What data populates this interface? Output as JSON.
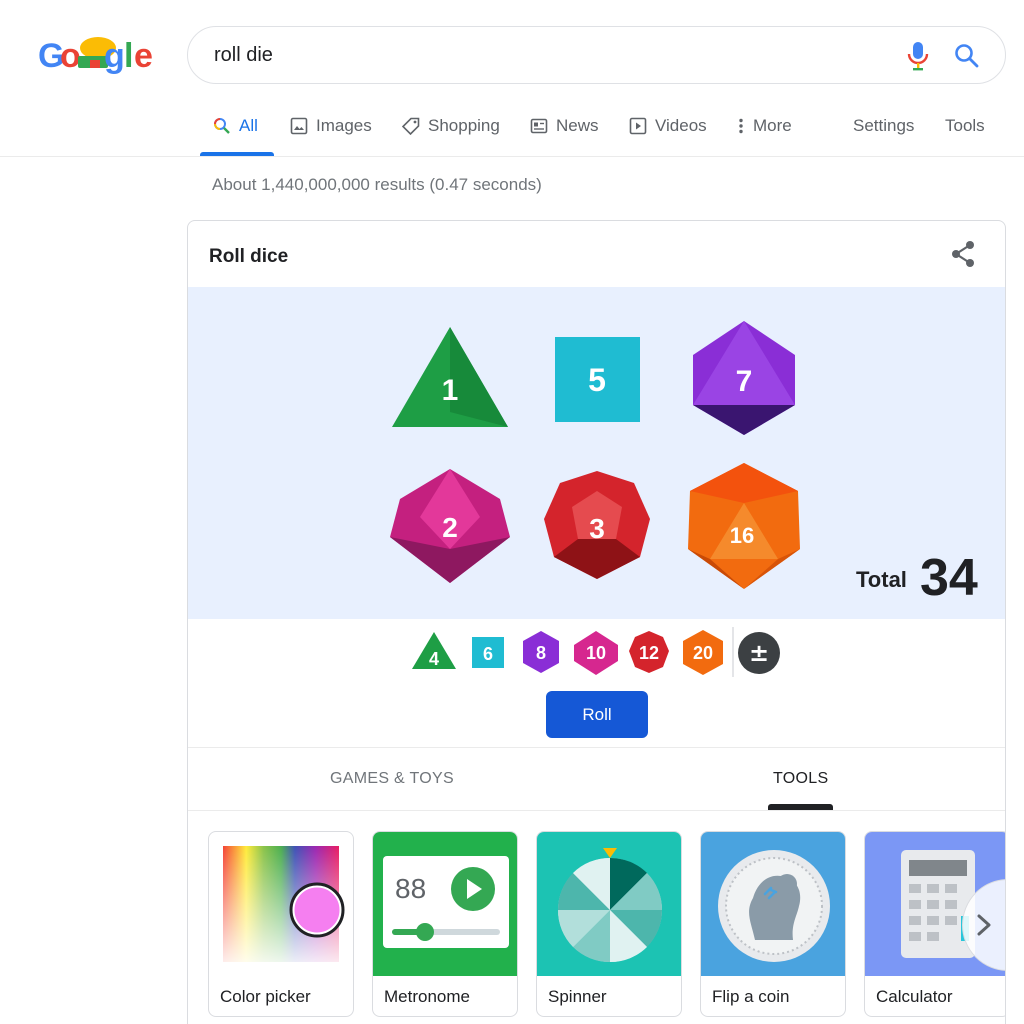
{
  "search": {
    "query": "roll die"
  },
  "tabs": [
    {
      "label": "All",
      "icon": "search-icon"
    },
    {
      "label": "Images",
      "icon": "image-icon"
    },
    {
      "label": "Shopping",
      "icon": "tag-icon"
    },
    {
      "label": "News",
      "icon": "news-icon"
    },
    {
      "label": "Videos",
      "icon": "play-icon"
    },
    {
      "label": "More",
      "icon": "more-vertical-icon"
    }
  ],
  "tools_links": {
    "settings": "Settings",
    "tools": "Tools"
  },
  "results_count": "About 1,440,000,000 results (0.47 seconds)",
  "card": {
    "title": "Roll dice",
    "dice": [
      {
        "sides": 4,
        "value": "1",
        "color": "#1e9e45"
      },
      {
        "sides": 6,
        "value": "5",
        "color": "#1fbcd2"
      },
      {
        "sides": 8,
        "value": "7",
        "color": "#8a2ed6"
      },
      {
        "sides": 10,
        "value": "2",
        "color": "#d6278f"
      },
      {
        "sides": 12,
        "value": "3",
        "color": "#d4242c"
      },
      {
        "sides": 20,
        "value": "16",
        "color": "#f26b0f"
      }
    ],
    "total_label": "Total",
    "total_value": "34",
    "picker": [
      "4",
      "6",
      "8",
      "10",
      "12",
      "20"
    ],
    "modifier_symbol": "±",
    "roll_label": "Roll",
    "categories": {
      "games": "GAMES & TOYS",
      "tools": "TOOLS"
    },
    "tiles": [
      {
        "label": "Color picker"
      },
      {
        "label": "Metronome",
        "display": "88"
      },
      {
        "label": "Spinner"
      },
      {
        "label": "Flip a coin"
      },
      {
        "label": "Calculator"
      }
    ]
  },
  "colors": {
    "accent": "#1a73e8",
    "roll_button": "#1558d6",
    "dice_bg": "#e8f0fe"
  }
}
